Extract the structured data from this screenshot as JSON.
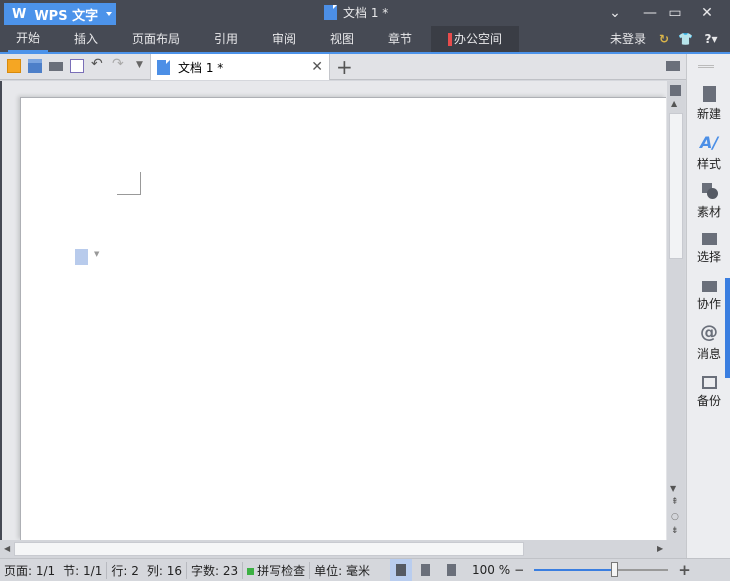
{
  "app": {
    "name": "WPS 文字",
    "document_title": "文档 1 *"
  },
  "menu": {
    "tabs": [
      "开始",
      "插入",
      "页面布局",
      "引用",
      "审阅",
      "视图",
      "章节",
      "办公空间"
    ],
    "login": "未登录",
    "help": "?"
  },
  "doc_tab": {
    "label": "文档 1 *"
  },
  "sidebar": {
    "items": [
      "新建",
      "样式",
      "素材",
      "选择",
      "协作",
      "消息",
      "备份"
    ]
  },
  "status": {
    "page": "页面: 1/1",
    "section": "节: 1/1",
    "row": "行: 2",
    "col": "列: 16",
    "words": "字数: 23",
    "spell": "拼写检查",
    "unit": "单位: 毫米",
    "zoom": "100 %"
  },
  "zoom_percent": 100,
  "colors": {
    "accent": "#4c93ea",
    "titlebar": "#464a54"
  }
}
